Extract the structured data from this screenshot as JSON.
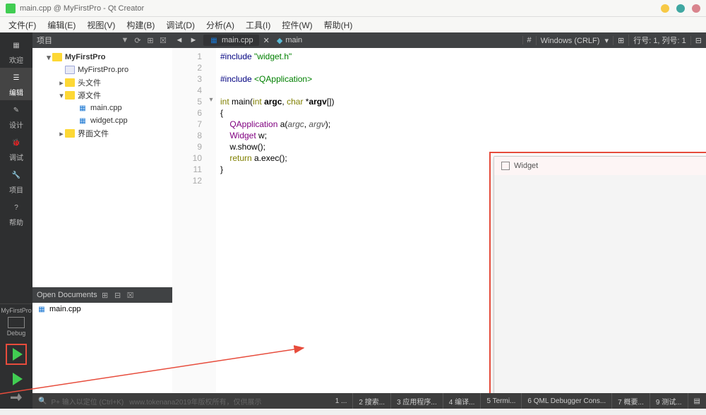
{
  "window": {
    "title": "main.cpp @ MyFirstPro - Qt Creator",
    "dots": [
      "#f7c945",
      "#3fa7a1",
      "#d9848d"
    ]
  },
  "menu": {
    "items": [
      "文件(F)",
      "编辑(E)",
      "视图(V)",
      "构建(B)",
      "调试(D)",
      "分析(A)",
      "工具(I)",
      "控件(W)",
      "帮助(H)"
    ]
  },
  "rail": {
    "items": [
      {
        "label": "欢迎",
        "icon": "grid"
      },
      {
        "label": "编辑",
        "icon": "edit",
        "active": true
      },
      {
        "label": "设计",
        "icon": "design"
      },
      {
        "label": "调试",
        "icon": "bug"
      },
      {
        "label": "项目",
        "icon": "wrench"
      },
      {
        "label": "帮助",
        "icon": "help"
      }
    ],
    "kit_name": "MyFirstPro",
    "kit_mode": "Debug"
  },
  "sidebar": {
    "tab": "项目",
    "tree": [
      {
        "level": 0,
        "arrow": "▾",
        "icon": "fold",
        "label": "MyFirstPro",
        "bold": true
      },
      {
        "level": 1,
        "arrow": "",
        "icon": "file",
        "label": "MyFirstPro.pro"
      },
      {
        "level": 1,
        "arrow": "▸",
        "icon": "fold",
        "label": "头文件"
      },
      {
        "level": 1,
        "arrow": "▾",
        "icon": "fold",
        "label": "源文件"
      },
      {
        "level": 2,
        "arrow": "",
        "icon": "cpp",
        "label": "main.cpp"
      },
      {
        "level": 2,
        "arrow": "",
        "icon": "cpp",
        "label": "widget.cpp"
      },
      {
        "level": 1,
        "arrow": "▸",
        "icon": "fold",
        "label": "界面文件"
      }
    ],
    "open_docs_hdr": "Open Documents",
    "open_docs": [
      {
        "icon": "cpp",
        "label": "main.cpp"
      }
    ]
  },
  "editor": {
    "tab_file": "main.cpp",
    "symbol": "main",
    "encoding_hash": "#",
    "line_ending": "Windows (CRLF)",
    "cursor": "行号: 1, 列号: 1",
    "lines": [
      {
        "n": 1,
        "html": "<span class='pp'>#include</span> <span class='str'>\"widget.h\"</span>"
      },
      {
        "n": 2,
        "html": ""
      },
      {
        "n": 3,
        "html": "<span class='pp'>#include</span> <span class='str'>&lt;QApplication&gt;</span>"
      },
      {
        "n": 4,
        "html": ""
      },
      {
        "n": 5,
        "html": "<span class='kw'>int</span> main(<span class='kw'>int</span> <b>argc</b>, <span class='kw'>char</span> *<b>argv</b>[])",
        "fold": "▾"
      },
      {
        "n": 6,
        "html": "{"
      },
      {
        "n": 7,
        "html": "    <span class='type'>QApplication</span> a(<span class='var'>argc</span>, <span class='var'>argv</span>);"
      },
      {
        "n": 8,
        "html": "    <span class='type'>Widget</span> w;"
      },
      {
        "n": 9,
        "html": "    w.show();"
      },
      {
        "n": 10,
        "html": "    <span class='kw'>return</span> a.exec();"
      },
      {
        "n": 11,
        "html": "}"
      },
      {
        "n": 12,
        "html": ""
      }
    ]
  },
  "widget_popup": {
    "title": "Widget",
    "dots": [
      "#f5a623",
      "#2a9d8f",
      "#d9848d"
    ]
  },
  "bottom": {
    "left_hint": "P+ 输入以定位 (Ctrl+K)",
    "items": [
      "1 ...",
      "2 搜索...",
      "3 应用程序...",
      "4 编译...",
      "5 Termi...",
      "6 QML Debugger Cons...",
      "7 概要...",
      "9 测试..."
    ],
    "watermark": "www.tokenana2019年版权所有，仅供展示"
  }
}
